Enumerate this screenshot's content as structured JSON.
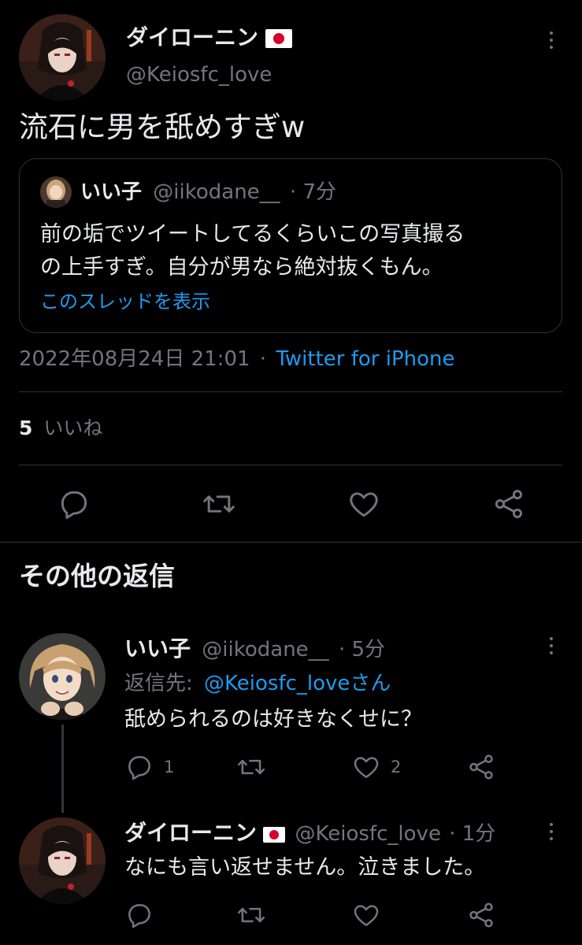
{
  "tweet": {
    "display_name": "ダイローニン",
    "handle": "@Keiosfc_love",
    "text": "流石に男を舐めすぎw",
    "quote": {
      "display_name": "いい子",
      "handle": "@iikodane__",
      "time": "· 7分",
      "text_line1": "前の垢でツイートしてるくらいこの写真撮る",
      "text_line2": "の上手すぎ。自分が男なら絶対抜くもん。",
      "show_thread": "このスレッドを表示"
    },
    "datetime": "2022年08月24日 21:01",
    "sep": "·",
    "source": "Twitter for iPhone",
    "likes_count": "5",
    "likes_label": "いいね"
  },
  "other_replies_header": "その他の返信",
  "replies": [
    {
      "display_name": "いい子",
      "handle": "@iikodane__",
      "time": "· 5分",
      "reply_to_label": "返信先:",
      "reply_to_handle": "@Keiosfc_loveさん",
      "text": "舐められるのは好きなくせに？",
      "reply_count": "1",
      "retweet_count": "",
      "like_count": "2"
    },
    {
      "display_name": "ダイローニン",
      "handle": "@Keiosfc_love",
      "time": "· 1分",
      "text": "なにも言い返せません。泣きました。",
      "reply_count": "",
      "retweet_count": "",
      "like_count": ""
    }
  ],
  "icons": {
    "reply": "reply-icon",
    "retweet": "retweet-icon",
    "like": "heart-icon",
    "share": "share-icon",
    "more": "more-icon",
    "flag": "japan-flag-icon"
  },
  "colors": {
    "background": "#000000",
    "text": "#e7e9ea",
    "muted": "#71767b",
    "link": "#1d9bf0",
    "divider": "#2f3336",
    "flag_red": "#d7002a"
  }
}
